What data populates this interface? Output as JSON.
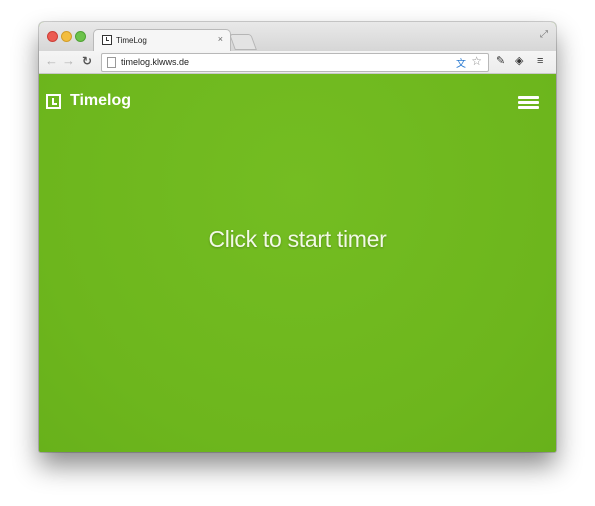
{
  "browser": {
    "tab_title": "TimeLog",
    "tab_close": "×",
    "url": "timelog.klwws.de",
    "icons": {
      "back": "arrow-left-icon",
      "forward": "arrow-right-icon",
      "reload": "reload-icon",
      "page": "page-icon",
      "translate": "translate-icon",
      "star": "star-icon",
      "pen": "pen-extension-icon",
      "stack": "stack-extension-icon",
      "menu": "menu-icon",
      "fullscreen": "fullscreen-icon"
    }
  },
  "app": {
    "logo_text": "Timelog",
    "cta": "Click to start timer",
    "colors": {
      "background": "#6fba1f",
      "text": "#ffffff"
    }
  }
}
